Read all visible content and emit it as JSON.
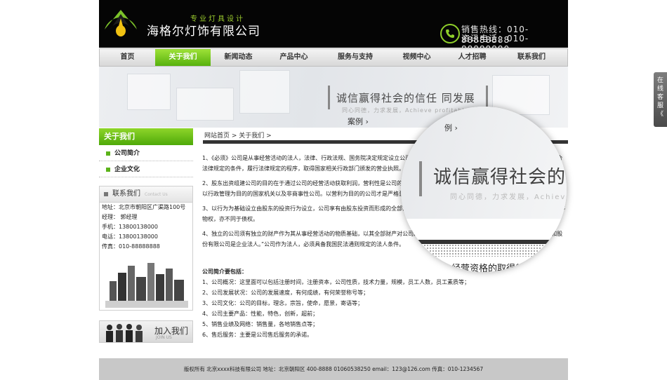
{
  "header": {
    "tagline": "专业灯具设计",
    "company": "海格尔灯饰有限公司",
    "hotline1": "销售热线：010-88888888",
    "hotline2": "资讯电话：010-88888880"
  },
  "nav": [
    "首页",
    "关于我们",
    "新闻动态",
    "产品中心",
    "服务与支持",
    "视频中心",
    "人才招聘",
    "联系我们"
  ],
  "banner": {
    "slogan": "诚信赢得社会的信任 同发展",
    "subtitle": "同心同德，力求发展，Achieve profitable growth",
    "case_text": "案例 ›"
  },
  "sidebar": {
    "title": "关于我们",
    "items": [
      "公司简介",
      "企业文化"
    ],
    "contact_title": "联系我们",
    "contact_title_en": "Contact Us",
    "contact_lines": [
      "地址：北京市朝阳区广渠路100号",
      "经理： 郭经理",
      "手机：13800138000",
      "电话：13800138000",
      "传真：010-88888888"
    ],
    "join_label": "加入我们",
    "join_en": "JOIN US"
  },
  "breadcrumb": "网站首页 > 关于我们 >",
  "content": {
    "paragraphs": [
      "1、《必须》公司是从事经营活动的法人，法律、行政法规、国务院决定规定设立公司必须报经批准的，应当在公司登记前依法办理批准手续，符合法律规定的条件，履行法律规定的程序，取得国家相关行政部门颁发的营业执照。",
      "2、股东出资组建公司的目的在于通过公司的经营活动获取利润，营利性是公司的本质特征。公司的营利性，使其不同于不以营利为目的公益法人、以行政管理为目的的国家机关以及非商事性公司。以营利为目的的公司才是严格意义上的公司。",
      "3、以行为为基础设立由股东的投资行为设立，公司享有由股东投资而形成的全部法人财产权，依法享有民事权利，承担民事责任，不同于经营权等物权，亦不同于债权。",
      "4、独立的公司须有独立的财产作为其从事经营活动的物质基础，以其全部财产对公司的债务承担责任。我国《公司法》规定：“有限责任公司和股份有限公司是企业法人。”公司作为法人，必须具备我国民法通则规定的法人条件。"
    ],
    "intro_title": "公司简介要包括：",
    "intro_items": [
      "1、公司概况：这里面可以包括注册时间，注册资本，公司性质，技术力量，规模，员工人数，员工素质等；",
      "2、公司发展状况：公司的发展速度，有何成绩，有何荣誉称号等；",
      "3、公司文化：公司的目标，理念，宗旨，使命，愿景，寄语等；",
      "4、公司主要产品：性能，特色，创新，超前；",
      "5、销售业绩及网络：销售量，各地销售点等；",
      "6、售后服务：主要是公司售后服务的承诺。"
    ]
  },
  "magnifier": {
    "slogan": "诚信赢得社会的信",
    "sub": "同心同德，力求发展，Achieve p",
    "case": "例 ›",
    "text": "经营资格的取得都需要得到"
  },
  "footer": "版权所有 北京xxxx科技有限公司 地址：北京朝阳区 400-8888 01060538250 email：123@126.com 传真：010-1234567",
  "online": [
    "在",
    "线",
    "客",
    "服",
    "《"
  ]
}
